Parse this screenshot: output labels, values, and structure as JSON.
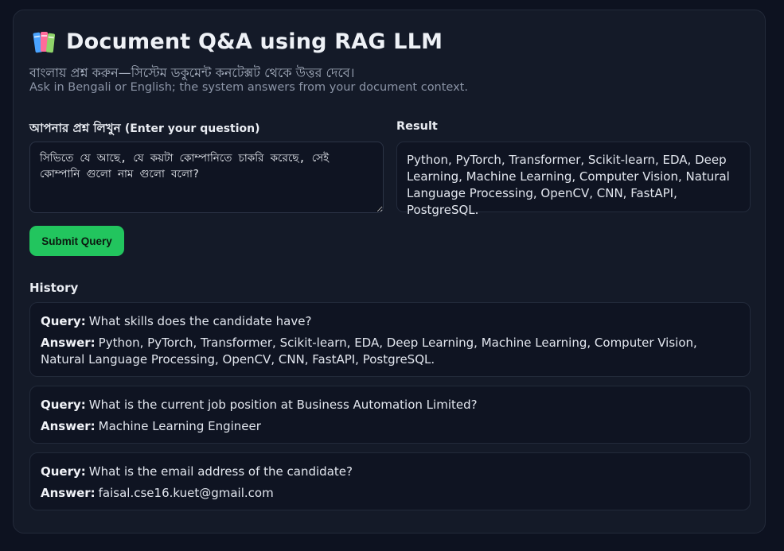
{
  "header": {
    "icon": "books-icon",
    "title": "Document Q&A using RAG LLM",
    "subtitle_bn": "বাংলায় প্রশ্ন করুন—সিস্টেম ডকুমেন্ট কনটেক্সট থেকে উত্তর দেবে।",
    "subtitle_en": "Ask in Bengali or English; the system answers from your document context."
  },
  "question": {
    "label_bn": "আপনার প্রশ্ন লিখুন",
    "label_en": "(Enter your question)",
    "value": "সিভিতে যে আছে, যে কয়টা কোম্পানিতে চাকরি করেছে, সেই কোম্পানি গুলো নাম গুলো বলো?"
  },
  "result": {
    "label": "Result",
    "text": "Python, PyTorch, Transformer, Scikit-learn, EDA, Deep Learning, Machine Learning, Computer Vision, Natural Language Processing, OpenCV, CNN, FastAPI, PostgreSQL."
  },
  "submit_label": "Submit Query",
  "history": {
    "label": "History",
    "query_key": "Query:",
    "answer_key": "Answer:",
    "items": [
      {
        "query": "What skills does the candidate have?",
        "answer": "Python, PyTorch, Transformer, Scikit-learn, EDA, Deep Learning, Machine Learning, Computer Vision, Natural Language Processing, OpenCV, CNN, FastAPI, PostgreSQL."
      },
      {
        "query": "What is the current job position at Business Automation Limited?",
        "answer": "Machine Learning Engineer"
      },
      {
        "query": "What is the email address of the candidate?",
        "answer": "faisal.cse16.kuet@gmail.com"
      }
    ]
  }
}
